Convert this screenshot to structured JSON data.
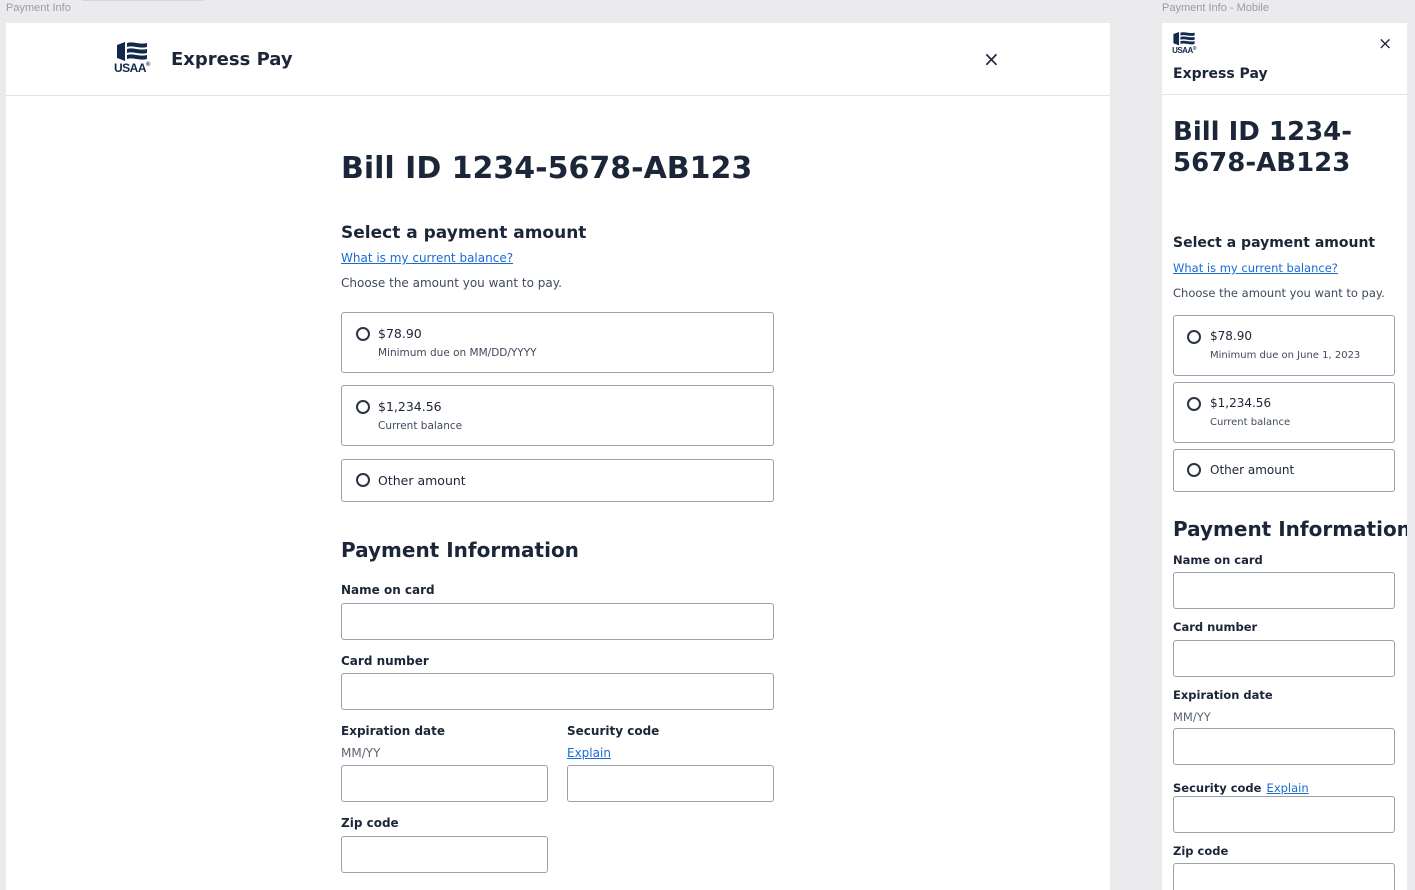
{
  "frames": {
    "desktop_label": "Payment Info",
    "mobile_label": "Payment Info - Mobile"
  },
  "brand": {
    "logo_text": "USAA",
    "logo_mark": "®",
    "app_name": "Express Pay",
    "close": "×"
  },
  "desktop": {
    "bill_title": "Bill ID 1234-5678-AB123",
    "select_heading": "Select a payment amount",
    "balance_link": "What is my current balance?",
    "choose_text": "Choose the amount you want to pay.",
    "options": [
      {
        "amount": "$78.90",
        "note": "Minimum due on MM/DD/YYYY"
      },
      {
        "amount": "$1,234.56",
        "note": "Current balance"
      },
      {
        "amount": "Other amount",
        "note": ""
      }
    ],
    "payment_heading": "Payment Information",
    "name_label": "Name on card",
    "card_label": "Card number",
    "exp_label": "Expiration date",
    "exp_hint": "MM/YY",
    "sec_label": "Security code",
    "sec_link": "Explain",
    "zip_label": "Zip code"
  },
  "mobile": {
    "bill_title": "Bill ID 1234-5678-AB123",
    "select_heading": "Select a payment amount",
    "balance_link": "What is my current balance?",
    "choose_text": "Choose the amount you want to pay.",
    "options": [
      {
        "amount": "$78.90",
        "note": "Minimum due on June 1, 2023"
      },
      {
        "amount": "$1,234.56",
        "note": "Current balance"
      },
      {
        "amount": "Other amount",
        "note": ""
      }
    ],
    "payment_heading": "Payment Information",
    "name_label": "Name on card",
    "card_label": "Card number",
    "exp_label": "Expiration date",
    "exp_hint": "MM/YY",
    "sec_label": "Security code",
    "sec_link": "Explain",
    "zip_label": "Zip code"
  },
  "colors": {
    "navy": "#1b2638",
    "link": "#1a6bd6",
    "logo": "#12284c"
  }
}
